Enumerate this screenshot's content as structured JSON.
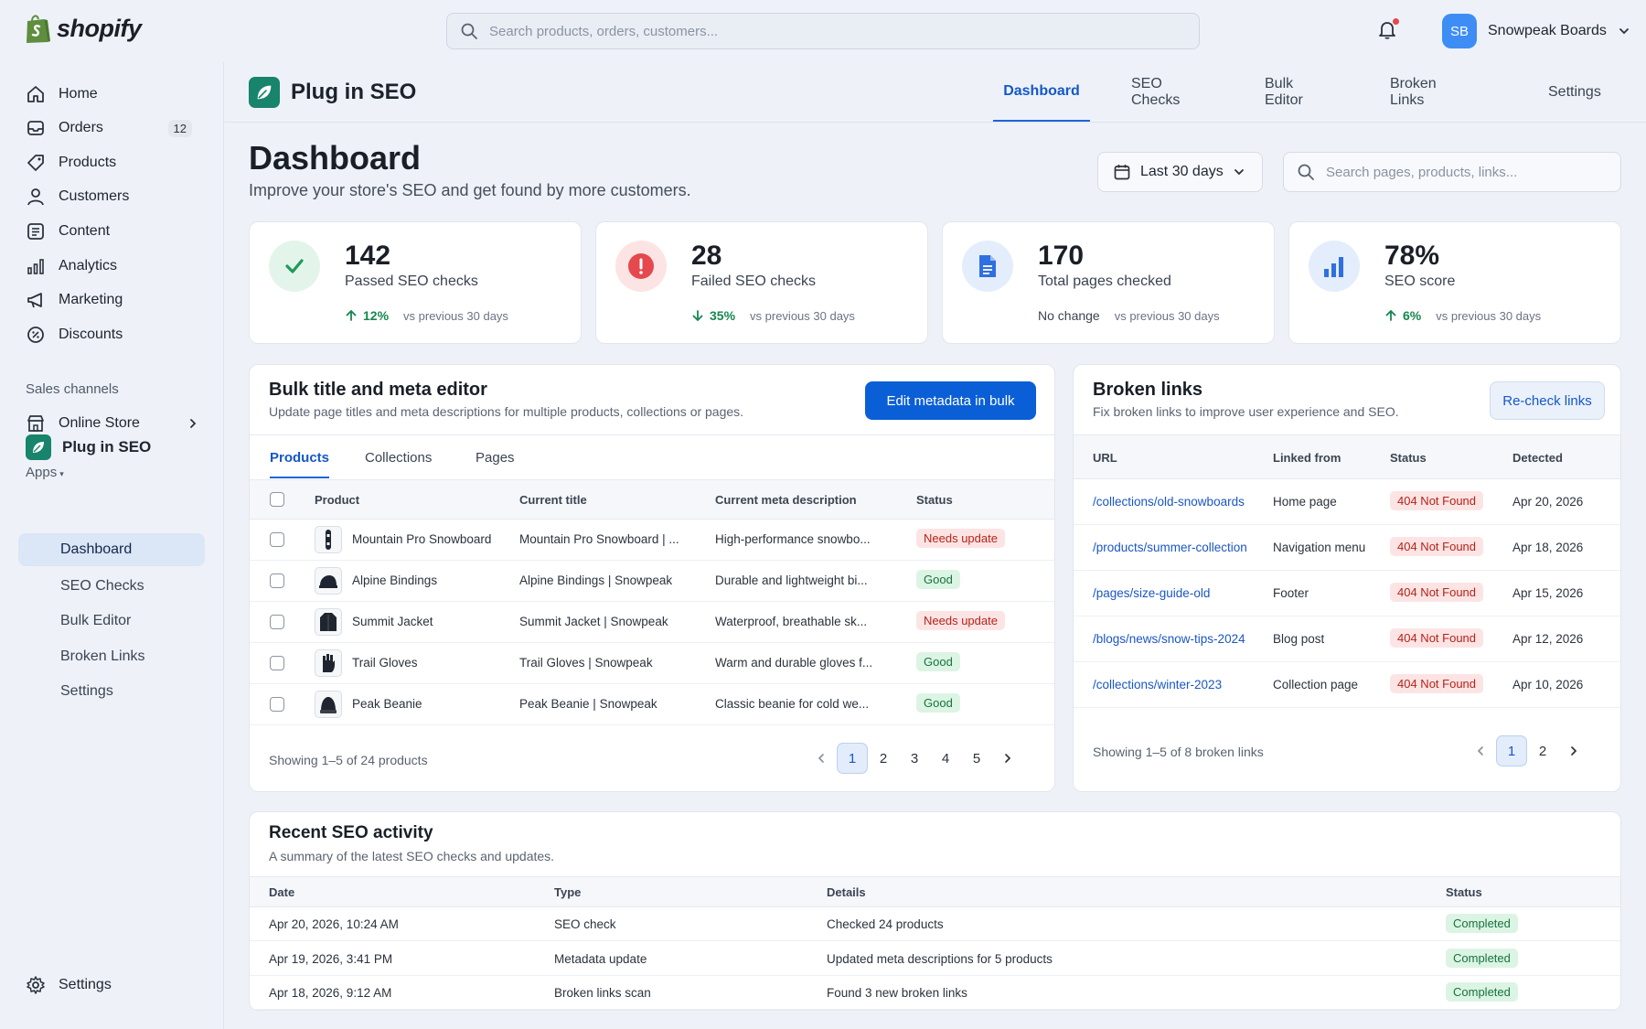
{
  "topbar": {
    "logo_text": "shopify",
    "search_placeholder": "Search products, orders, customers...",
    "avatar_initials": "SB",
    "store_name": "Snowpeak Boards"
  },
  "sidebar": {
    "items": [
      {
        "label": "Home",
        "icon": "home-icon"
      },
      {
        "label": "Orders",
        "icon": "inbox-icon",
        "badge": "12"
      },
      {
        "label": "Products",
        "icon": "tag-icon"
      },
      {
        "label": "Customers",
        "icon": "person-icon"
      },
      {
        "label": "Content",
        "icon": "document-icon"
      },
      {
        "label": "Analytics",
        "icon": "bar-chart-icon"
      },
      {
        "label": "Marketing",
        "icon": "megaphone-icon"
      },
      {
        "label": "Discounts",
        "icon": "discount-icon"
      }
    ],
    "sales_channels_label": "Sales channels",
    "online_store": "Online Store",
    "apps_label": "Apps",
    "app_name": "Plug in SEO",
    "sub_items": [
      "Dashboard",
      "SEO Checks",
      "Bulk Editor",
      "Broken Links",
      "Settings"
    ],
    "settings": "Settings"
  },
  "app": {
    "name": "Plug in SEO",
    "tabs": [
      "Dashboard",
      "SEO Checks",
      "Bulk Editor",
      "Broken Links",
      "Settings"
    ]
  },
  "page": {
    "title": "Dashboard",
    "subtitle": "Improve your store's SEO and get found by more customers.",
    "date_range": "Last 30 days",
    "search_placeholder": "Search pages, products, links..."
  },
  "stats": [
    {
      "value": "142",
      "label": "Passed SEO checks",
      "change": "12%",
      "direction": "up",
      "vs": "vs previous 30 days"
    },
    {
      "value": "28",
      "label": "Failed SEO checks",
      "change": "35%",
      "direction": "down",
      "vs": "vs previous 30 days"
    },
    {
      "value": "170",
      "label": "Total pages checked",
      "change": "No change",
      "direction": "none",
      "vs": "vs previous 30 days"
    },
    {
      "value": "78%",
      "label": "SEO score",
      "change": "6%",
      "direction": "up",
      "vs": "vs previous 30 days"
    }
  ],
  "bulk": {
    "title": "Bulk title and meta editor",
    "subtitle": "Update page titles and meta descriptions for multiple products, collections or pages.",
    "button": "Edit metadata in bulk",
    "tabs": [
      "Products",
      "Collections",
      "Pages"
    ],
    "columns": [
      "Product",
      "Current title",
      "Current meta description",
      "Status"
    ],
    "rows": [
      {
        "product": "Mountain Pro Snowboard",
        "title": "Mountain Pro Snowboard | ...",
        "meta": "High-performance snowbo...",
        "status": "Needs update",
        "thumb": "snowboard-icon"
      },
      {
        "product": "Alpine Bindings",
        "title": "Alpine Bindings | Snowpeak",
        "meta": "Durable and lightweight bi...",
        "status": "Good",
        "thumb": "bindings-icon"
      },
      {
        "product": "Summit Jacket",
        "title": "Summit Jacket | Snowpeak",
        "meta": "Waterproof, breathable sk...",
        "status": "Needs update",
        "thumb": "jacket-icon"
      },
      {
        "product": "Trail Gloves",
        "title": "Trail Gloves | Snowpeak",
        "meta": "Warm and durable gloves f...",
        "status": "Good",
        "thumb": "gloves-icon"
      },
      {
        "product": "Peak Beanie",
        "title": "Peak Beanie | Snowpeak",
        "meta": "Classic beanie for cold we...",
        "status": "Good",
        "thumb": "beanie-icon"
      }
    ],
    "showing": "Showing 1–5 of 24 products",
    "pages": [
      "1",
      "2",
      "3",
      "4",
      "5"
    ]
  },
  "broken": {
    "title": "Broken links",
    "subtitle": "Fix broken links to improve user experience and SEO.",
    "button": "Re-check links",
    "columns": [
      "URL",
      "Linked from",
      "Status",
      "Detected"
    ],
    "rows": [
      {
        "url": "/collections/old-snowboards",
        "from": "Home page",
        "status": "404 Not Found",
        "date": "Apr 20, 2026"
      },
      {
        "url": "/products/summer-collection",
        "from": "Navigation menu",
        "status": "404 Not Found",
        "date": "Apr 18, 2026"
      },
      {
        "url": "/pages/size-guide-old",
        "from": "Footer",
        "status": "404 Not Found",
        "date": "Apr 15, 2026"
      },
      {
        "url": "/blogs/news/snow-tips-2024",
        "from": "Blog post",
        "status": "404 Not Found",
        "date": "Apr 12, 2026"
      },
      {
        "url": "/collections/winter-2023",
        "from": "Collection page",
        "status": "404 Not Found",
        "date": "Apr 10, 2026"
      }
    ],
    "showing": "Showing 1–5 of 8 broken links",
    "pages": [
      "1",
      "2"
    ]
  },
  "activity": {
    "title": "Recent SEO activity",
    "subtitle": "A summary of the latest SEO checks and updates.",
    "columns": [
      "Date",
      "Type",
      "Details",
      "Status"
    ],
    "rows": [
      {
        "date": "Apr 20, 2026, 10:24 AM",
        "type": "SEO check",
        "details": "Checked 24 products",
        "status": "Completed"
      },
      {
        "date": "Apr 19, 2026, 3:41 PM",
        "type": "Metadata update",
        "details": "Updated meta descriptions for 5 products",
        "status": "Completed"
      },
      {
        "date": "Apr 18, 2026, 9:12 AM",
        "type": "Broken links scan",
        "details": "Found 3 new broken links",
        "status": "Completed"
      }
    ]
  },
  "colors": {
    "accent": "#0b5fd6",
    "app_green": "#17846b",
    "good": "#17733f",
    "bad": "#b42318"
  }
}
